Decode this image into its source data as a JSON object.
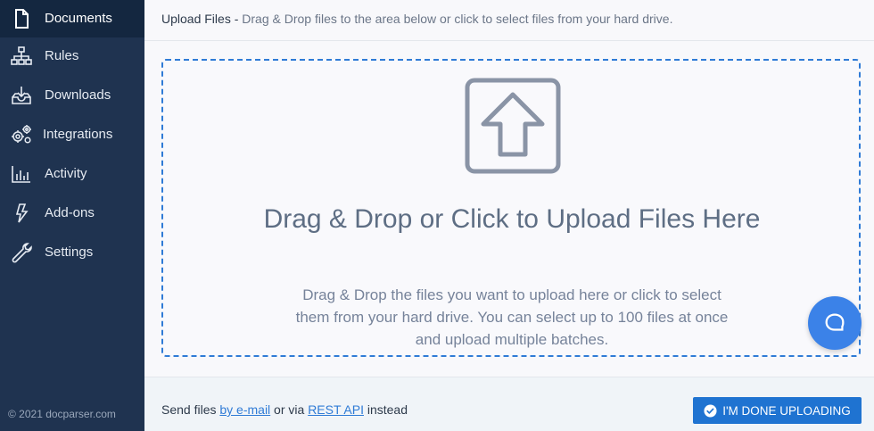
{
  "sidebar": {
    "items": [
      {
        "label": "Documents",
        "icon": "document-icon",
        "active": true
      },
      {
        "label": "Rules",
        "icon": "sitemap-icon"
      },
      {
        "label": "Downloads",
        "icon": "download-tray-icon"
      },
      {
        "label": "Integrations",
        "icon": "gears-icon"
      },
      {
        "label": "Activity",
        "icon": "bar-chart-icon"
      },
      {
        "label": "Add-ons",
        "icon": "bolt-icon"
      },
      {
        "label": "Settings",
        "icon": "wrench-icon"
      }
    ],
    "footer": "© 2021 docparser.com"
  },
  "header": {
    "title": "Upload Files - ",
    "description": "Drag & Drop files to the area below or click to select files from your hard drive."
  },
  "dropzone": {
    "icon": "upload-arrow-icon",
    "heading": "Drag & Drop or Click to Upload Files Here",
    "subtext": "Drag & Drop the files you want to upload here or click to select them from your hard drive. You can select up to 100 files at once and upload multiple batches."
  },
  "bottom": {
    "send_prefix": "Send files ",
    "email_link": "by e-mail",
    "via_text": " or via ",
    "api_link": "REST API",
    "suffix": " instead",
    "done_button": "I'M DONE UPLOADING"
  },
  "colors": {
    "sidebar_bg": "#1f3350",
    "sidebar_active": "#142740",
    "accent": "#1f73d1",
    "dropzone_border": "#2f7bd6",
    "chat_bubble": "#3b82e8"
  }
}
